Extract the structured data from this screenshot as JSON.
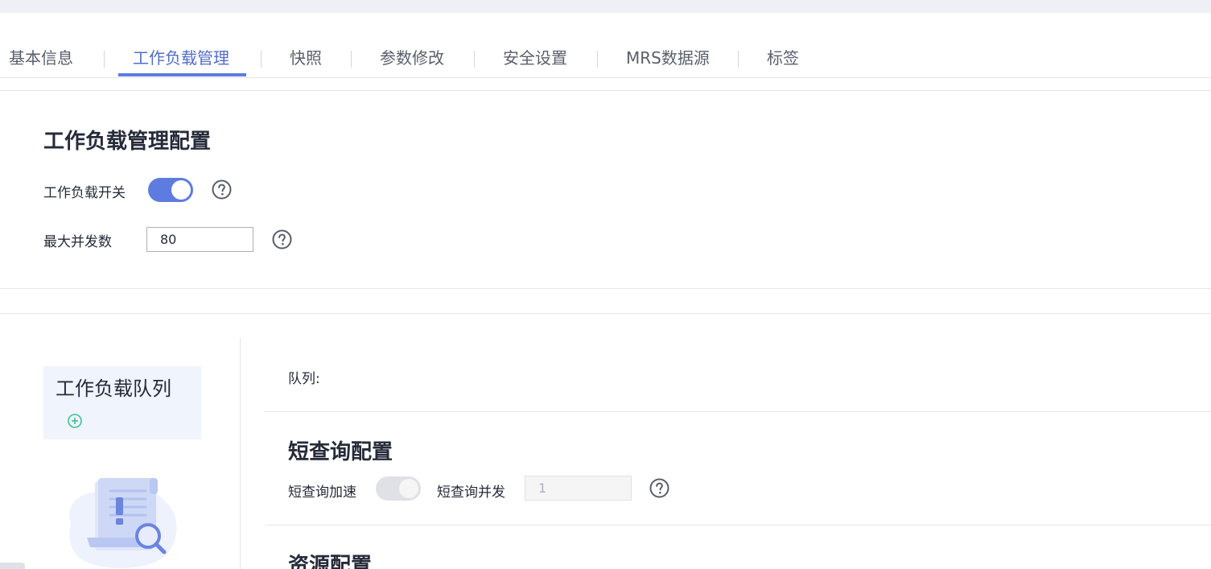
{
  "tabs": [
    {
      "label": "基本信息",
      "active": false
    },
    {
      "label": "工作负载管理",
      "active": true
    },
    {
      "label": "快照",
      "active": false
    },
    {
      "label": "参数修改",
      "active": false
    },
    {
      "label": "安全设置",
      "active": false
    },
    {
      "label": "MRS数据源",
      "active": false
    },
    {
      "label": "标签",
      "active": false
    }
  ],
  "workload_config": {
    "title": "工作负载管理配置",
    "switch_label": "工作负载开关",
    "switch_on": true,
    "max_concurrency_label": "最大并发数",
    "max_concurrency_value": "80"
  },
  "queue_panel": {
    "title": "工作负载队列",
    "add_icon": "plus-circle-icon",
    "empty_icon": "empty-document-search-icon"
  },
  "queue_detail": {
    "queue_label": "队列:",
    "short_query": {
      "title": "短查询配置",
      "accel_label": "短查询加速",
      "accel_on": false,
      "concurrency_label": "短查询并发",
      "concurrency_value": "1"
    },
    "resource": {
      "title": "资源配置"
    }
  },
  "colors": {
    "accent": "#5e7ce0",
    "active_tab_text": "#526ecc",
    "add_icon": "#3ac295"
  }
}
